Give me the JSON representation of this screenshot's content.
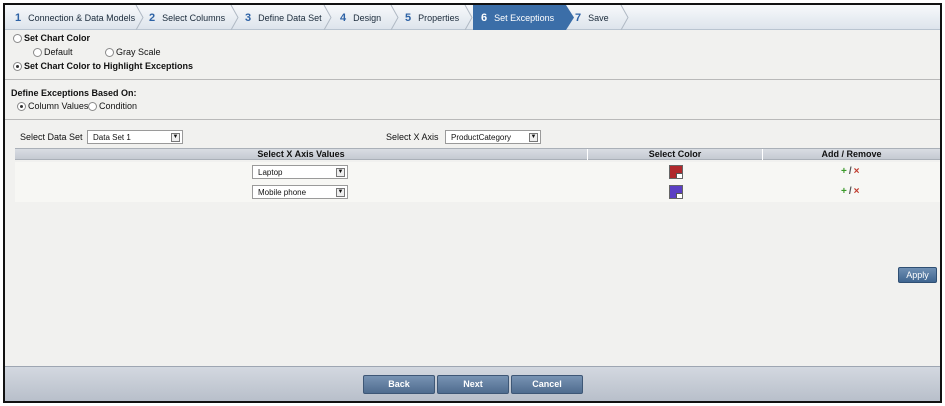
{
  "wizard": {
    "steps": [
      {
        "num": "1",
        "label": "Connection & Data Models"
      },
      {
        "num": "2",
        "label": "Select Columns"
      },
      {
        "num": "3",
        "label": "Define Data Set"
      },
      {
        "num": "4",
        "label": "Design"
      },
      {
        "num": "5",
        "label": "Properties"
      },
      {
        "num": "6",
        "label": "Set Exceptions"
      },
      {
        "num": "7",
        "label": "Save"
      }
    ],
    "active_index": 5
  },
  "chart_color": {
    "set_chart_color": "Set Chart Color",
    "default": "Default",
    "gray_scale": "Gray Scale",
    "highlight_exceptions": "Set Chart Color to Highlight Exceptions"
  },
  "exceptions": {
    "heading": "Define Exceptions Based On:",
    "column_values": "Column Values",
    "condition": "Condition"
  },
  "data_set": {
    "select_data_set_label": "Select Data Set",
    "data_set_value": "Data Set 1",
    "select_x_axis_label": "Select X Axis",
    "x_axis_value": "ProductCategory"
  },
  "grid": {
    "headers": {
      "x_axis_values": "Select X Axis Values",
      "select_color": "Select Color",
      "add_remove": "Add / Remove"
    },
    "rows": [
      {
        "value": "Laptop",
        "color": "#b0282c"
      },
      {
        "value": "Mobile phone",
        "color": "#5b3fc4"
      }
    ],
    "add_symbol": "+",
    "sep_symbol": "/",
    "remove_symbol": "×"
  },
  "buttons": {
    "apply": "Apply",
    "back": "Back",
    "next": "Next",
    "cancel": "Cancel"
  },
  "colors": {
    "accent": "#3b6ea8",
    "laptop": "#b0282c",
    "mobile_phone": "#5b3fc4"
  }
}
